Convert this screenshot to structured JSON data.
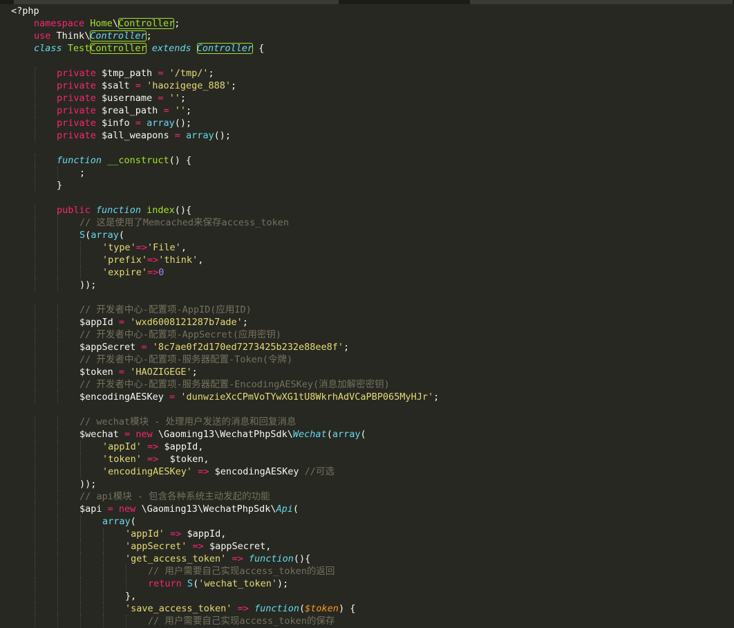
{
  "editor": {
    "language": "php",
    "lines": [
      [
        {
          "c": "p",
          "x": "<?php"
        }
      ],
      [
        {
          "c": "k",
          "x": "namespace"
        },
        {
          "c": "p",
          "x": " "
        },
        {
          "c": "f",
          "x": "Home"
        },
        {
          "c": "p",
          "x": "\\"
        },
        {
          "c": "f",
          "x": "Controller",
          "box": true
        },
        {
          "c": "p",
          "x": ";"
        }
      ],
      [
        {
          "c": "k",
          "x": "use"
        },
        {
          "c": "p",
          "x": " Think\\"
        },
        {
          "c": "t",
          "x": "Controller",
          "box": true
        },
        {
          "c": "p",
          "x": ";"
        }
      ],
      [
        {
          "c": "t",
          "x": "class"
        },
        {
          "c": "p",
          "x": " "
        },
        {
          "c": "f",
          "x": "Test"
        },
        {
          "c": "f",
          "x": "Controller",
          "box": true
        },
        {
          "c": "p",
          "x": " "
        },
        {
          "c": "t",
          "x": "extends"
        },
        {
          "c": "p",
          "x": " "
        },
        {
          "c": "f",
          "x": "Controller",
          "box": true,
          "it": true
        },
        {
          "c": "p",
          "x": " {"
        }
      ],
      [],
      [
        {
          "c": "k",
          "x": "private"
        },
        {
          "c": "p",
          "x": " $tmp_path "
        },
        {
          "c": "k",
          "x": "="
        },
        {
          "c": "p",
          "x": " "
        },
        {
          "c": "s",
          "x": "'/tmp/'"
        },
        {
          "c": "p",
          "x": ";"
        }
      ],
      [
        {
          "c": "k",
          "x": "private"
        },
        {
          "c": "p",
          "x": " $salt "
        },
        {
          "c": "k",
          "x": "="
        },
        {
          "c": "p",
          "x": " "
        },
        {
          "c": "s",
          "x": "'haozigege_888'"
        },
        {
          "c": "p",
          "x": ";"
        }
      ],
      [
        {
          "c": "k",
          "x": "private"
        },
        {
          "c": "p",
          "x": " $username "
        },
        {
          "c": "k",
          "x": "="
        },
        {
          "c": "p",
          "x": " "
        },
        {
          "c": "s",
          "x": "''"
        },
        {
          "c": "p",
          "x": ";"
        }
      ],
      [
        {
          "c": "k",
          "x": "private"
        },
        {
          "c": "p",
          "x": " $real_path "
        },
        {
          "c": "k",
          "x": "="
        },
        {
          "c": "p",
          "x": " "
        },
        {
          "c": "s",
          "x": "''"
        },
        {
          "c": "p",
          "x": ";"
        }
      ],
      [
        {
          "c": "k",
          "x": "private"
        },
        {
          "c": "p",
          "x": " $info "
        },
        {
          "c": "k",
          "x": "="
        },
        {
          "c": "p",
          "x": " "
        },
        {
          "c": "b",
          "x": "array"
        },
        {
          "c": "p",
          "x": "();"
        }
      ],
      [
        {
          "c": "k",
          "x": "private"
        },
        {
          "c": "p",
          "x": " $all_weapons "
        },
        {
          "c": "k",
          "x": "="
        },
        {
          "c": "p",
          "x": " "
        },
        {
          "c": "b",
          "x": "array"
        },
        {
          "c": "p",
          "x": "();"
        }
      ],
      [],
      [
        {
          "c": "t",
          "x": "function"
        },
        {
          "c": "p",
          "x": " "
        },
        {
          "c": "f",
          "x": "__construct"
        },
        {
          "c": "p",
          "x": "() {"
        }
      ],
      [
        {
          "c": "p",
          "x": ";"
        }
      ],
      [
        {
          "c": "p",
          "x": "}"
        }
      ],
      [],
      [
        {
          "c": "k",
          "x": "public"
        },
        {
          "c": "p",
          "x": " "
        },
        {
          "c": "t",
          "x": "function"
        },
        {
          "c": "p",
          "x": " "
        },
        {
          "c": "f",
          "x": "index"
        },
        {
          "c": "p",
          "x": "(){"
        }
      ],
      [
        {
          "c": "c",
          "x": "// 这是使用了Memcached来保存access_token"
        }
      ],
      [
        {
          "c": "b",
          "x": "S"
        },
        {
          "c": "p",
          "x": "("
        },
        {
          "c": "b",
          "x": "array"
        },
        {
          "c": "p",
          "x": "("
        }
      ],
      [
        {
          "c": "s",
          "x": "'type'"
        },
        {
          "c": "k",
          "x": "=>"
        },
        {
          "c": "s",
          "x": "'File'"
        },
        {
          "c": "p",
          "x": ","
        }
      ],
      [
        {
          "c": "s",
          "x": "'prefix'"
        },
        {
          "c": "k",
          "x": "=>"
        },
        {
          "c": "s",
          "x": "'think'"
        },
        {
          "c": "p",
          "x": ","
        }
      ],
      [
        {
          "c": "s",
          "x": "'expire'"
        },
        {
          "c": "k",
          "x": "=>"
        },
        {
          "c": "n",
          "x": "0"
        }
      ],
      [
        {
          "c": "p",
          "x": "));"
        }
      ],
      [],
      [
        {
          "c": "c",
          "x": "// 开发者中心-配置项-AppID(应用ID)"
        }
      ],
      [
        {
          "c": "p",
          "x": "$appId "
        },
        {
          "c": "k",
          "x": "="
        },
        {
          "c": "p",
          "x": " "
        },
        {
          "c": "s",
          "x": "'wxd6008121287b7ade'"
        },
        {
          "c": "p",
          "x": ";"
        }
      ],
      [
        {
          "c": "c",
          "x": "// 开发者中心-配置项-AppSecret(应用密钥)"
        }
      ],
      [
        {
          "c": "p",
          "x": "$appSecret "
        },
        {
          "c": "k",
          "x": "="
        },
        {
          "c": "p",
          "x": " "
        },
        {
          "c": "s",
          "x": "'8c7ae0f2d170ed7273425b232e88ee8f'"
        },
        {
          "c": "p",
          "x": ";"
        }
      ],
      [
        {
          "c": "c",
          "x": "// 开发者中心-配置项-服务器配置-Token(令牌)"
        }
      ],
      [
        {
          "c": "p",
          "x": "$token "
        },
        {
          "c": "k",
          "x": "="
        },
        {
          "c": "p",
          "x": " "
        },
        {
          "c": "s",
          "x": "'HAOZIGEGE'"
        },
        {
          "c": "p",
          "x": ";"
        }
      ],
      [
        {
          "c": "c",
          "x": "// 开发者中心-配置项-服务器配置-EncodingAESKey(消息加解密密钥)"
        }
      ],
      [
        {
          "c": "p",
          "x": "$encodingAESKey "
        },
        {
          "c": "k",
          "x": "="
        },
        {
          "c": "p",
          "x": " "
        },
        {
          "c": "s",
          "x": "'dunwzieXcCPmVoTYwXG1tU8WkrhAdVCaPBP065MyHJr'"
        },
        {
          "c": "p",
          "x": ";"
        }
      ],
      [],
      [
        {
          "c": "c",
          "x": "// wechat模块 - 处理用户发送的消息和回复消息"
        }
      ],
      [
        {
          "c": "p",
          "x": "$wechat "
        },
        {
          "c": "k",
          "x": "="
        },
        {
          "c": "p",
          "x": " "
        },
        {
          "c": "k",
          "x": "new"
        },
        {
          "c": "p",
          "x": " \\Gaoming13\\WechatPhpSdk\\"
        },
        {
          "c": "t",
          "x": "Wechat"
        },
        {
          "c": "p",
          "x": "("
        },
        {
          "c": "b",
          "x": "array"
        },
        {
          "c": "p",
          "x": "("
        }
      ],
      [
        {
          "c": "s",
          "x": "'appId'"
        },
        {
          "c": "p",
          "x": " "
        },
        {
          "c": "k",
          "x": "=>"
        },
        {
          "c": "p",
          "x": " $appId,"
        }
      ],
      [
        {
          "c": "s",
          "x": "'token'"
        },
        {
          "c": "p",
          "x": " "
        },
        {
          "c": "k",
          "x": "=>"
        },
        {
          "c": "p",
          "x": "  $token,"
        }
      ],
      [
        {
          "c": "s",
          "x": "'encodingAESKey'"
        },
        {
          "c": "p",
          "x": " "
        },
        {
          "c": "k",
          "x": "=>"
        },
        {
          "c": "p",
          "x": " $encodingAESKey "
        },
        {
          "c": "c",
          "x": "//可选"
        }
      ],
      [
        {
          "c": "p",
          "x": "));"
        }
      ],
      [
        {
          "c": "c",
          "x": "// api模块 - 包含各种系统主动发起的功能"
        }
      ],
      [
        {
          "c": "p",
          "x": "$api "
        },
        {
          "c": "k",
          "x": "="
        },
        {
          "c": "p",
          "x": " "
        },
        {
          "c": "k",
          "x": "new"
        },
        {
          "c": "p",
          "x": " \\Gaoming13\\WechatPhpSdk\\"
        },
        {
          "c": "t",
          "x": "Api"
        },
        {
          "c": "p",
          "x": "("
        }
      ],
      [
        {
          "c": "b",
          "x": "array"
        },
        {
          "c": "p",
          "x": "("
        }
      ],
      [
        {
          "c": "s",
          "x": "'appId'"
        },
        {
          "c": "p",
          "x": " "
        },
        {
          "c": "k",
          "x": "=>"
        },
        {
          "c": "p",
          "x": " $appId,"
        }
      ],
      [
        {
          "c": "s",
          "x": "'appSecret'"
        },
        {
          "c": "p",
          "x": " "
        },
        {
          "c": "k",
          "x": "=>"
        },
        {
          "c": "p",
          "x": " $appSecret,"
        }
      ],
      [
        {
          "c": "s",
          "x": "'get_access_token'"
        },
        {
          "c": "p",
          "x": " "
        },
        {
          "c": "k",
          "x": "=>"
        },
        {
          "c": "p",
          "x": " "
        },
        {
          "c": "t",
          "x": "function"
        },
        {
          "c": "p",
          "x": "(){"
        }
      ],
      [
        {
          "c": "c",
          "x": "// 用户需要自己实现access_token的返回"
        }
      ],
      [
        {
          "c": "k",
          "x": "return"
        },
        {
          "c": "p",
          "x": " "
        },
        {
          "c": "b",
          "x": "S"
        },
        {
          "c": "p",
          "x": "("
        },
        {
          "c": "s",
          "x": "'wechat_token'"
        },
        {
          "c": "p",
          "x": ");"
        }
      ],
      [
        {
          "c": "p",
          "x": "},"
        }
      ],
      [
        {
          "c": "s",
          "x": "'save_access_token'"
        },
        {
          "c": "p",
          "x": " "
        },
        {
          "c": "k",
          "x": "=>"
        },
        {
          "c": "p",
          "x": " "
        },
        {
          "c": "t",
          "x": "function"
        },
        {
          "c": "p",
          "x": "("
        },
        {
          "c": "v",
          "x": "$token"
        },
        {
          "c": "p",
          "x": ") {"
        }
      ],
      [
        {
          "c": "c",
          "x": "// 用户需要自己实现access_token的保存"
        }
      ]
    ]
  }
}
